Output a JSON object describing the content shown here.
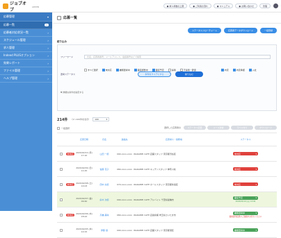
{
  "header": {
    "logo_text": "ジョブオプ",
    "logo_sub": "ADMIN",
    "nav": [
      "● 求人枠数の上限",
      "● ご利用の流れ",
      "● マニュアル",
      "● お問い合わせ"
    ],
    "account": "管理"
  },
  "sidebar": {
    "items": [
      {
        "label": "応募管理",
        "badge": "",
        "active": true
      },
      {
        "label": "応募一覧",
        "badge": "1"
      },
      {
        "label": "応募者対応状況一覧",
        "badge": ""
      },
      {
        "label": "スケジュール管理",
        "badge": ""
      },
      {
        "label": "求人管理",
        "badge": ""
      },
      {
        "label": "Indeed PLUSオプション",
        "badge": ""
      },
      {
        "label": "効果レポート",
        "badge": ""
      },
      {
        "label": "ファイル管理",
        "badge": ""
      },
      {
        "label": "ヘルプ管理",
        "badge": ""
      }
    ]
  },
  "page": {
    "title": "応募一覧"
  },
  "tabs": [
    "ステータスフローチャート",
    "応募者データダウンロード",
    "一括登録"
  ],
  "search": {
    "heading": "絞り込み",
    "keyword_label": "フリーワード",
    "keyword_placeholder": "氏名、応募者番号、メールアドレス、電話番号などで検索",
    "status_label": "選考ステータス",
    "status_options": [
      {
        "label": "すべて選択",
        "checked": false
      },
      {
        "label": "未対応",
        "checked": true
      },
      {
        "label": "書類選考中",
        "checked": true
      },
      {
        "label": "面接調整中",
        "checked": true
      },
      {
        "label": "面接予定",
        "checked": true
      },
      {
        "label": "採用",
        "checked": false
      },
      {
        "label": "不採用・辞退",
        "checked": false
      },
      {
        "label": "内定",
        "checked": true
      },
      {
        "label": "内定承諾",
        "checked": true
      },
      {
        "label": "入社",
        "checked": true
      }
    ],
    "more_label": "▼ 詳細な条件を指定する",
    "clear_label": "条件をクリアにする",
    "submit_label": "絞り込む"
  },
  "results": {
    "count": "214件",
    "range": "（1〜100件を表示）",
    "per_page": "100",
    "bulk_select": "一括選択",
    "bulk_label": "選択した応募者の",
    "bulk_actions": [
      "ステータス変更",
      "メール送信",
      "ラベル付け",
      "ダウンロード"
    ]
  },
  "table": {
    "headers": [
      "",
      "",
      "応募日時",
      "氏名",
      "連絡先",
      "応募求人・勤務地",
      "ステータス"
    ],
    "rows": [
      {
        "status": "未対応",
        "date": "2020/02/10 (月) 17:10",
        "name": "山田 一郎",
        "contact": "090-xxxx-xxxx",
        "job": "WARAMEI CAFE 店舗スタッフ 東京都渋谷区",
        "state": "未対応",
        "note": "",
        "hl": false
      },
      {
        "status": "",
        "date": "2020/02/09 (日) 11:25",
        "name": "佐藤 花子",
        "contact": "080-xxxx-xxxx",
        "job": "WARAMEI CAFE キッチンスタッフ 神奈川県",
        "state": "未対応",
        "note": "",
        "hl": false
      },
      {
        "status": "未対応",
        "date": "2020/02/08 (土) 14:03",
        "name": "田中 太郎",
        "contact": "070-xxxx-xxxx",
        "job": "WARAMEI CAFE ホールスタッフ 東京都新宿区",
        "state": "未対応",
        "note": "",
        "hl": false
      },
      {
        "status": "",
        "date": "2020/02/07 (金) 09:40",
        "name": "鈴木 次郎",
        "contact": "090-xxxx-xxxx",
        "job": "WARAMEI CAFE アルバイト 千葉県船橋市",
        "state": "面接予定",
        "note": "2020/03/10 (火) 13:00",
        "hl": true
      },
      {
        "status": "未対応",
        "date": "2020/02/06 (木) 18:22",
        "name": "高橋 美咲",
        "contact": "080-xxxx-xxxx",
        "job": "WARAMEI CAFE 店長候補 埼玉県さいたま市",
        "state": "書類選考中",
        "note": "書類選考結果のご連絡をお待ちください",
        "hl": false
      },
      {
        "status": "",
        "date": "2020/02/05 (水) 10:15",
        "name": "伊藤 健",
        "contact": "090-xxxx-xxxx",
        "job": "WARAMEI CAFE 店舗スタッフ 東京都港区",
        "state": "書類選考中",
        "note": "",
        "hl": false
      }
    ]
  }
}
